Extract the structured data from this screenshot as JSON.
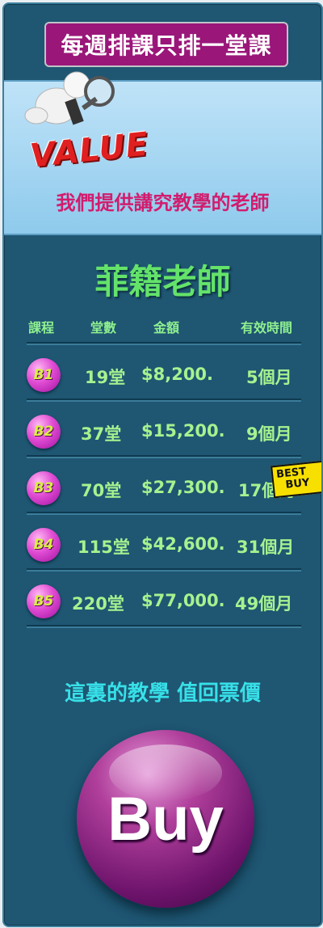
{
  "header": {
    "badge": "每週排課只排一堂課"
  },
  "value_panel": {
    "value_word": "VALUE",
    "subtitle": "我們提供講究教學的老師"
  },
  "pricing": {
    "title": "菲籍老師",
    "columns": [
      "課程",
      "堂數",
      "金額",
      "有效時間"
    ],
    "rows": [
      {
        "code": "B1",
        "lessons": "19堂",
        "price": "$8,200.",
        "validity": "5個月"
      },
      {
        "code": "B2",
        "lessons": "37堂",
        "price": "$15,200.",
        "validity": "9個月"
      },
      {
        "code": "B3",
        "lessons": "70堂",
        "price": "$27,300.",
        "validity": "17個月"
      },
      {
        "code": "B4",
        "lessons": "115堂",
        "price": "$42,600.",
        "validity": "31個月"
      },
      {
        "code": "B5",
        "lessons": "220堂",
        "price": "$77,000.",
        "validity": "49個月"
      }
    ],
    "best_buy_badge": {
      "line1": "BEST",
      "line2": "BUY"
    }
  },
  "tagline": "這裏的教學 值回票價",
  "buy_button": {
    "label": "Buy"
  },
  "colors": {
    "background": "#1f5672",
    "badge": "#9a1679",
    "title_green": "#64e36a",
    "pill_magenta": "#e04cd3",
    "tagline_cyan": "#37e0e8",
    "buy_purple": "#6d136b"
  }
}
